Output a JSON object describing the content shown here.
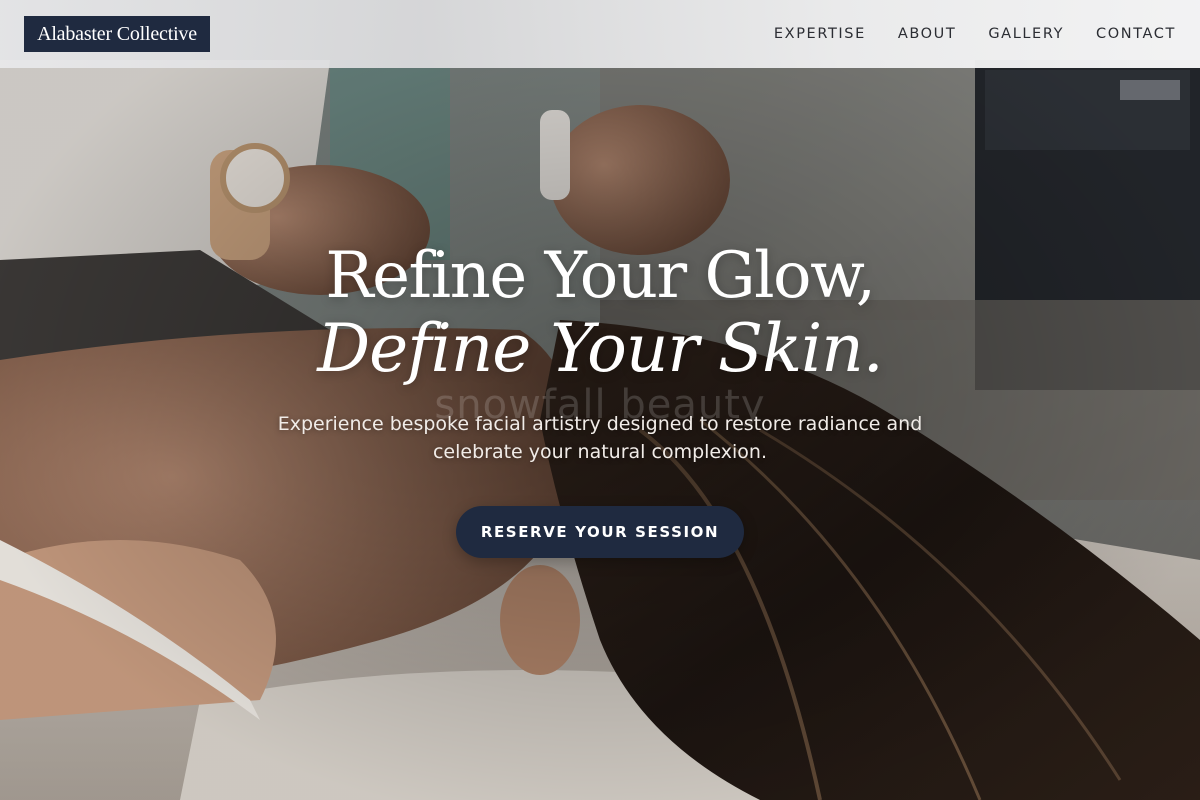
{
  "header": {
    "logo_text": "Alabaster Collective",
    "nav": [
      {
        "label": "EXPERTISE"
      },
      {
        "label": "ABOUT"
      },
      {
        "label": "GALLERY"
      },
      {
        "label": "CONTACT"
      }
    ]
  },
  "hero": {
    "headline_line1": "Refine Your Glow,",
    "headline_line2": "Define Your Skin.",
    "watermark": "snowfall beauty",
    "subtitle": "Experience bespoke facial artistry designed to restore radiance and celebrate your natural complexion.",
    "cta_label": "RESERVE YOUR SESSION",
    "image_subject": "esthetician performing facial treatment on client lying on treatment bed"
  },
  "colors": {
    "brand_navy": "#1f2a40",
    "header_bg": "#ececed",
    "nav_text": "#2b2d33",
    "hero_text": "#ffffff"
  }
}
